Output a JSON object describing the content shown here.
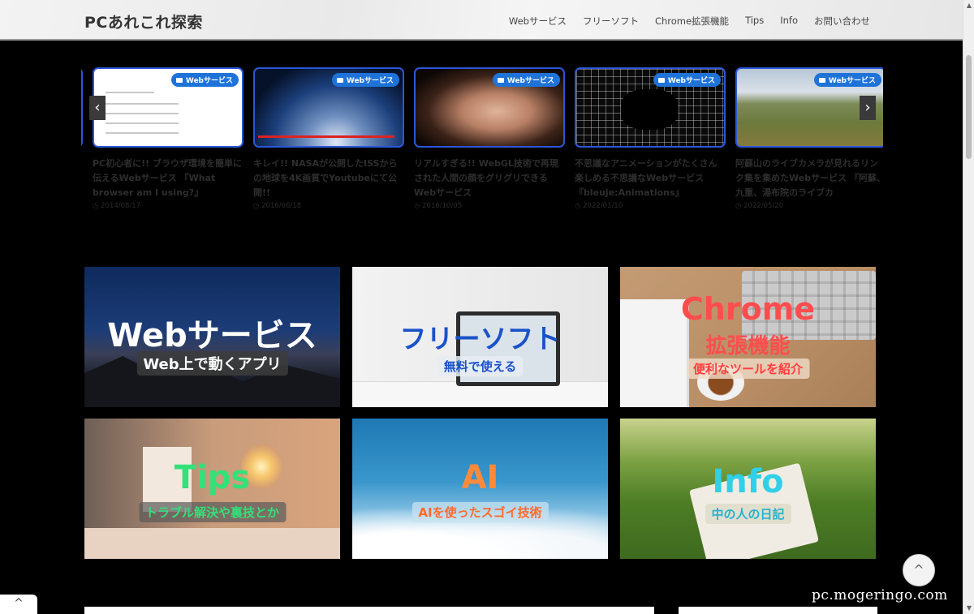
{
  "site": {
    "title": "PCあれこれ探索"
  },
  "nav": {
    "items": [
      "Webサービス",
      "フリーソフト",
      "Chrome拡張機能",
      "Tips",
      "Info",
      "お問い合わせ"
    ]
  },
  "carousel": {
    "prev_icon": "chevron-left-icon",
    "next_icon": "chevron-right-icon",
    "prev_glyph": "‹",
    "next_glyph": "›",
    "cards": [
      {
        "badge": "Webサービス",
        "title": "PC初心者に!! ブラウザ環境を簡単に伝えるWebサービス 『What browser am I using?』",
        "date": "2014/08/17"
      },
      {
        "badge": "Webサービス",
        "title": "キレイ!! NASAが公開したISSからの地球を4K画質でYoutubeにて公開!!",
        "date": "2016/06/18"
      },
      {
        "badge": "Webサービス",
        "title": "リアルすぎる!! WebGL技術で再現された人間の顔をグリグリできるWebサービス",
        "date": "2016/10/05"
      },
      {
        "badge": "Webサービス",
        "title": "不思議なアニメーションがたくさん楽しめる不思議なWebサービス 『bleuje:Animations』",
        "date": "2022/01/10"
      },
      {
        "badge": "Webサービス",
        "title": "阿蘇山のライブカメラが見れるリンク集を集めたWebサービス 『阿蘇、九重、湯布院のライブカ",
        "date": "2022/05/20"
      }
    ]
  },
  "categories": {
    "web": {
      "title": "Webサービス",
      "sub": "Web上で動くアプリ"
    },
    "free": {
      "title": "フリーソフト",
      "sub": "無料で使える"
    },
    "chrome": {
      "title": "Chrome",
      "title2": "拡張機能",
      "sub": "便利なツールを紹介"
    },
    "tips": {
      "title": "Tips",
      "sub": "トラブル解決や裏技とか"
    },
    "ai": {
      "title": "AI",
      "sub": "AIを使ったスゴイ技術"
    },
    "info": {
      "title": "Info",
      "sub": "中の人の日記"
    }
  },
  "ui": {
    "back_to_top": "^",
    "bottom_tab": "^",
    "watermark": "pc.mogeringo.com"
  },
  "colors": {
    "badge": "#1e73d9",
    "card_border": "#2b57d8",
    "chrome_accent": "#ff4d4d",
    "tips_accent": "#33e07a",
    "ai_accent": "#ff8a3d",
    "info_accent": "#2fd0e8",
    "free_accent": "#1a52c9"
  }
}
